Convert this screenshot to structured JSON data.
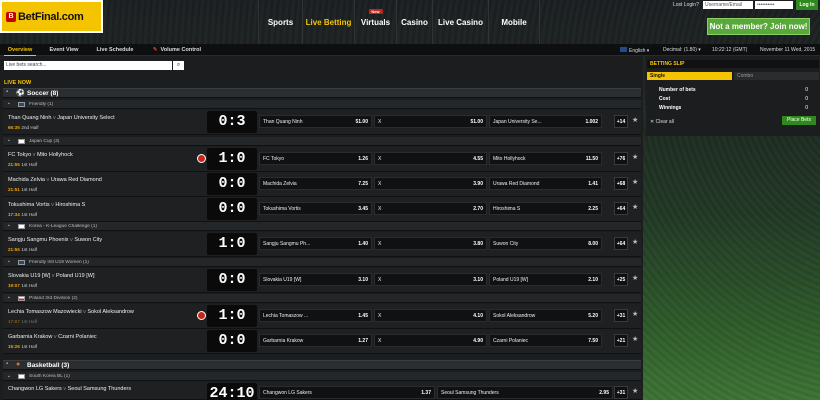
{
  "logo": {
    "badge": "B",
    "text": "BetFinal.com"
  },
  "nav": {
    "items": [
      {
        "label": "Sports"
      },
      {
        "label": "Live Betting"
      },
      {
        "label": "Virtuals",
        "badge": "New"
      },
      {
        "label": "Casino"
      },
      {
        "label": "Live Casino"
      },
      {
        "label": "Mobile"
      }
    ]
  },
  "login": {
    "lost_link": "Lost Login?",
    "username": "Username/Email",
    "password": "••••••••••",
    "button": "Log In"
  },
  "join": "Not a member? Join now!",
  "subnav": {
    "tabs": [
      "Overview",
      "Event View",
      "Live Schedule",
      "Volume Control"
    ],
    "language": "English",
    "odds": "Decimal: (1.80)",
    "time": "10:22:12 (GMT)",
    "date": "November 11 Wed, 2015"
  },
  "search": {
    "placeholder": "Live bets search..."
  },
  "live_now": "LIVE NOW",
  "soccer": {
    "title": "Soccer (8)",
    "competitions": [
      {
        "name": "Friendly (1)",
        "matches": [
          {
            "teams": "Than Quang Ninh",
            "away": "Japan University Select",
            "time": "66:35",
            "period": "2nd Half",
            "score": "0:3",
            "o1": "Than Quang Ninh",
            "v1": "51.00",
            "ox": "X",
            "vx": "51.00",
            "o2": "Japan University Se...",
            "v2": "1.002",
            "more": "+14"
          }
        ]
      },
      {
        "name": "Japan Cup (3)",
        "matches": [
          {
            "teams": "FC Tokyo",
            "away": "Mito Hollyhock",
            "time": "21:55",
            "period": "1st Half",
            "score": "1:0",
            "o1": "FC Tokyo",
            "v1": "1.26",
            "ox": "X",
            "vx": "4.55",
            "o2": "Mito Hollyhock",
            "v2": "11.50",
            "more": "+76"
          },
          {
            "teams": "Machida Zelvia",
            "away": "Urawa Red Diamond",
            "time": "21:51",
            "period": "1st Half",
            "score": "0:0",
            "o1": "Machida Zelvia",
            "v1": "7.25",
            "ox": "X",
            "vx": "3.90",
            "o2": "Urawa Red Diamond",
            "v2": "1.41",
            "more": "+68"
          },
          {
            "teams": "Tokushima Vortis",
            "away": "Hiroshima S",
            "time": "17:34",
            "period": "1st Half",
            "score": "0:0",
            "o1": "Tokushima Vortis",
            "v1": "3.45",
            "ox": "X",
            "vx": "2.70",
            "o2": "Hiroshima S",
            "v2": "2.25",
            "more": "+64"
          }
        ]
      },
      {
        "name": "Korea - K-League Challenge (1)",
        "matches": [
          {
            "teams": "Sangju Sangmu Phoenix",
            "away": "Suwon City",
            "time": "21:55",
            "period": "1st Half",
            "score": "1:0",
            "o1": "Sangju Sangmu Ph...",
            "v1": "1.40",
            "ox": "X",
            "vx": "3.80",
            "o2": "Suwon City",
            "v2": "8.00",
            "more": "+64"
          }
        ]
      },
      {
        "name": "Friendly Intl U19 Women (1)",
        "matches": [
          {
            "teams": "Slovakia U19 [W]",
            "away": "Poland U19 [W]",
            "time": "19:07",
            "period": "1st Half",
            "score": "0:0",
            "o1": "Slovakia U19 [W]",
            "v1": "3.10",
            "ox": "X",
            "vx": "3.10",
            "o2": "Poland U19 [W]",
            "v2": "2.10",
            "more": "+25"
          }
        ]
      },
      {
        "name": "Poland 3rd Division (2)",
        "matches": [
          {
            "teams": "Lechia Tomaszow Mazowiecki",
            "away": "Sokol Aleksandrow",
            "time": "17:67",
            "period": "1st Half",
            "score": "1:0",
            "o1": "Lechia Tomaszow ...",
            "v1": "1.45",
            "ox": "X",
            "vx": "4.10",
            "o2": "Sokol Aleksandrow",
            "v2": "5.20",
            "more": "+31"
          },
          {
            "teams": "Garbarnia Krakow",
            "away": "Czarni Polaniec",
            "time": "15:26",
            "period": "1st Half",
            "score": "0:0",
            "o1": "Garbarnia Krakow",
            "v1": "1.27",
            "ox": "X",
            "vx": "4.90",
            "o2": "Czarni Polaniec",
            "v2": "7.50",
            "more": "+21"
          }
        ]
      }
    ]
  },
  "basketball": {
    "title": "Basketball (3)",
    "competition": "South Korea BL (1)",
    "match": {
      "teams": "Changwon LG Sakers",
      "away": "Seoul Samsung Thunders",
      "score": "24:10",
      "o1": "Changwon LG Sakers",
      "v1": "1.37",
      "o2": "Seoul Samsung Thunders",
      "v2": "2.95",
      "more": "+31"
    }
  },
  "slip": {
    "title": "BETTING SLIP",
    "tabs": [
      "Single",
      "Combo"
    ],
    "lines": [
      {
        "label": "Number of bets",
        "value": "0"
      },
      {
        "label": "Cost",
        "value": "0"
      },
      {
        "label": "Winnings",
        "value": "0"
      }
    ],
    "clear": "Clear all",
    "place": "Place Bets"
  },
  "colors": {
    "accent": "#f5c400",
    "live": "#f5a300",
    "green": "#2f8a1e"
  }
}
